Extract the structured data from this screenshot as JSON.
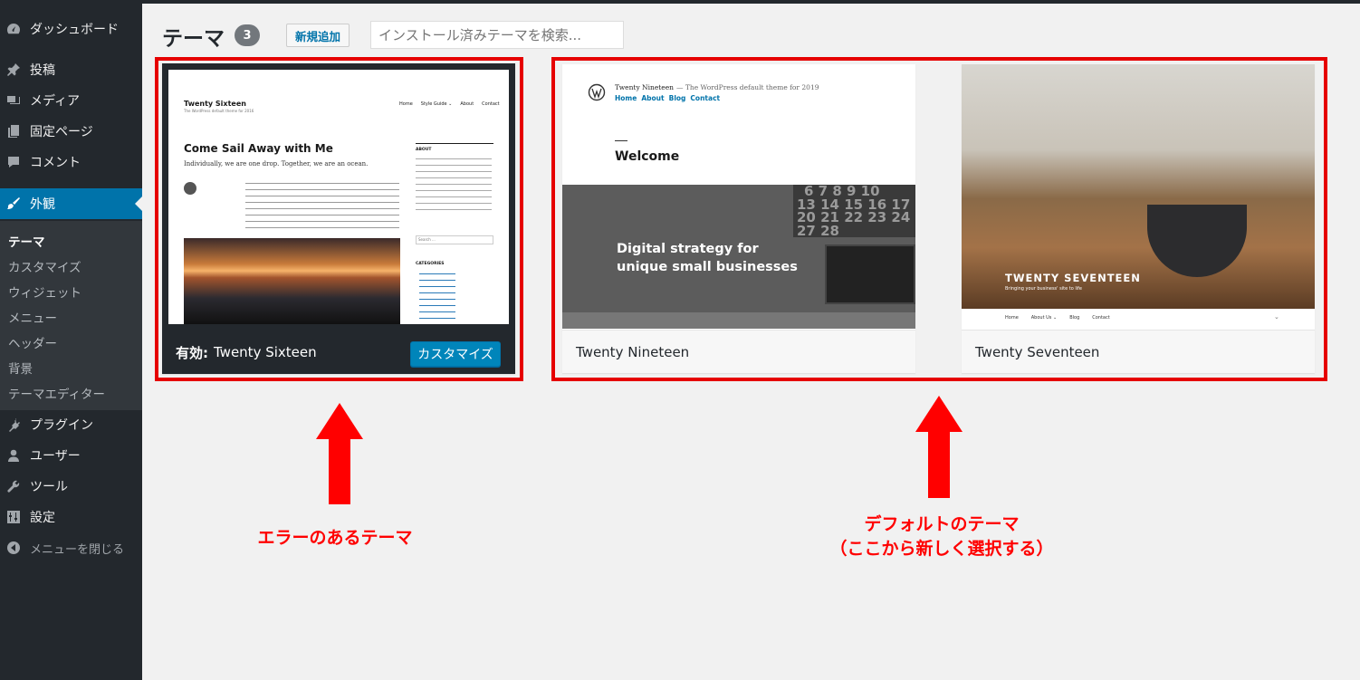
{
  "sidebar": {
    "items": [
      {
        "id": "dashboard",
        "label": "ダッシュボード",
        "icon": "dashboard-icon"
      },
      {
        "id": "posts",
        "label": "投稿",
        "icon": "pin-icon"
      },
      {
        "id": "media",
        "label": "メディア",
        "icon": "media-icon"
      },
      {
        "id": "pages",
        "label": "固定ページ",
        "icon": "page-icon"
      },
      {
        "id": "comments",
        "label": "コメント",
        "icon": "comment-icon"
      },
      {
        "id": "appearance",
        "label": "外観",
        "icon": "brush-icon",
        "active": true
      },
      {
        "id": "plugins",
        "label": "プラグイン",
        "icon": "plug-icon"
      },
      {
        "id": "users",
        "label": "ユーザー",
        "icon": "user-icon"
      },
      {
        "id": "tools",
        "label": "ツール",
        "icon": "wrench-icon"
      },
      {
        "id": "settings",
        "label": "設定",
        "icon": "settings-icon"
      }
    ],
    "submenu": [
      "テーマ",
      "カスタマイズ",
      "ウィジェット",
      "メニュー",
      "ヘッダー",
      "背景",
      "テーマエディター"
    ],
    "collapse_label": "メニューを閉じる"
  },
  "header": {
    "title": "テーマ",
    "count": "3",
    "add_new_label": "新規追加",
    "search_placeholder": "インストール済みテーマを検索..."
  },
  "themes": {
    "active": {
      "active_prefix": "有効:",
      "name": "Twenty Sixteen",
      "customize_label": "カスタマイズ",
      "preview": {
        "site_title": "Twenty Sixteen",
        "tagline": "The WordPress default theme for 2016",
        "nav": [
          "Home",
          "Style Guide ⌄",
          "About",
          "Contact"
        ],
        "post_title": "Come Sail Away with Me",
        "post_intro": "Individually, we are one drop. Together, we are an ocean.",
        "widget_about": "ABOUT",
        "widget_search": "Search ...",
        "widget_categories": "CATEGORIES"
      }
    },
    "t19": {
      "name": "Twenty Nineteen",
      "preview": {
        "site_title": "Twenty Nineteen",
        "tagline": "— The WordPress default theme for 2019",
        "nav": [
          "Home",
          "About",
          "Blog",
          "Contact"
        ],
        "heading": "Welcome",
        "hero_line1": "Digital strategy for",
        "hero_line2": "unique small businesses",
        "calendar_rows": [
          "6 7 8 9 10",
          "13 14 15 16 17",
          "20 21 22 23 24",
          "27 28"
        ]
      }
    },
    "t17": {
      "name": "Twenty Seventeen",
      "preview": {
        "site_title": "TWENTY SEVENTEEN",
        "tagline": "Bringing your business' site to life",
        "nav": [
          "Home",
          "About Us ⌄",
          "Blog",
          "Contact"
        ]
      }
    }
  },
  "annotations": {
    "left_note": "エラーのあるテーマ",
    "right_note_line1": "デフォルトのテーマ",
    "right_note_line2": "（ここから新しく選択する）",
    "color": "#ff0000"
  }
}
